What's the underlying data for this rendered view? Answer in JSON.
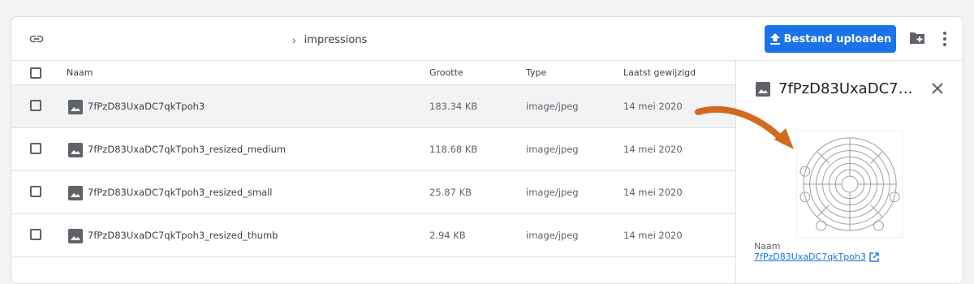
{
  "toolbar": {
    "breadcrumb_sep": "›",
    "breadcrumb": "impressions",
    "upload_label": "Bestand uploaden"
  },
  "table": {
    "headers": {
      "name": "Naam",
      "size": "Grootte",
      "type": "Type",
      "modified": "Laatst gewijzigd"
    },
    "rows": [
      {
        "name": "7fPzD83UxaDC7qkTpoh3",
        "size": "183.34 KB",
        "type": "image/jpeg",
        "modified": "14 mei 2020"
      },
      {
        "name": "7fPzD83UxaDC7qkTpoh3_resized_medium",
        "size": "118.68 KB",
        "type": "image/jpeg",
        "modified": "14 mei 2020"
      },
      {
        "name": "7fPzD83UxaDC7qkTpoh3_resized_small",
        "size": "25.87 KB",
        "type": "image/jpeg",
        "modified": "14 mei 2020"
      },
      {
        "name": "7fPzD83UxaDC7qkTpoh3_resized_thumb",
        "size": "2.94 KB",
        "type": "image/jpeg",
        "modified": "14 mei 2020"
      }
    ]
  },
  "panel": {
    "title": "7fPzD83UxaDC7qkTpoh3",
    "name_label": "Naam",
    "name_value": "7fPzD83UxaDC7qkTpoh3"
  },
  "colors": {
    "primary": "#1a73e8",
    "selected_row": "#f1f3f4",
    "annotation_arrow": "#d2691e"
  },
  "icons": [
    "link-icon",
    "upload-icon",
    "new-folder-icon",
    "more-vert-icon",
    "image-icon",
    "close-icon",
    "open-external-icon"
  ]
}
